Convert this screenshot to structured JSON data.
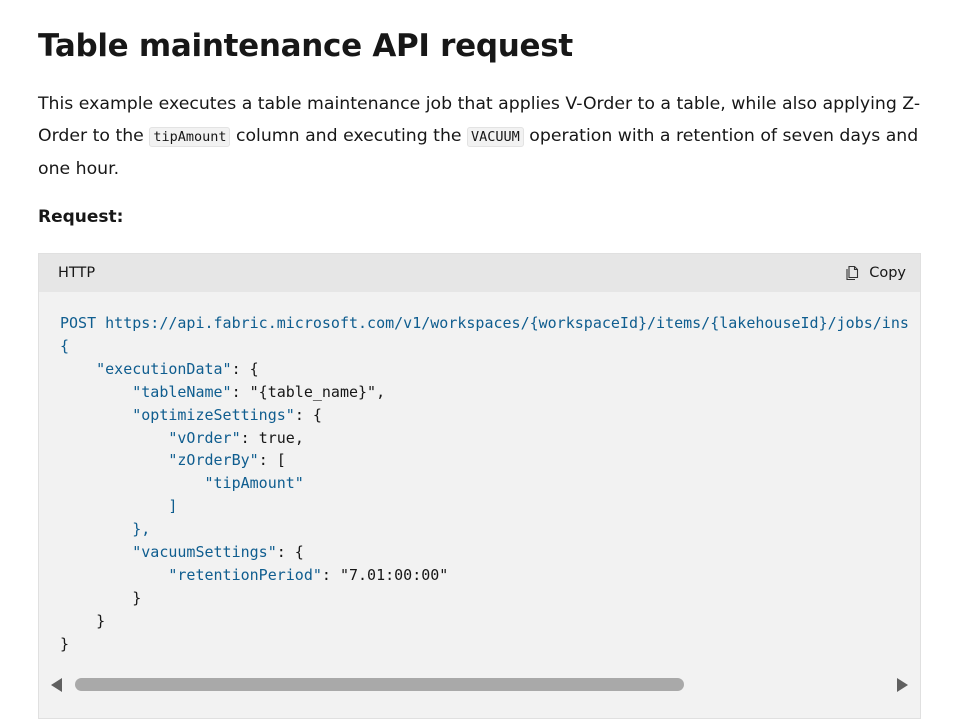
{
  "heading": "Table maintenance API request",
  "paragraph": {
    "line1": "This example executes a table maintenance job that applies V-Order to a table, while also applying Z-",
    "line2_pre": "Order to the ",
    "line2_code1": "tipAmount",
    "line2_mid": " column and executing the ",
    "line2_code2": "VACUUM",
    "line2_post": " operation with a retention of seven days and",
    "line3": "one hour."
  },
  "request_label": "Request:",
  "code_block": {
    "language": "HTTP",
    "copy_label": "Copy",
    "method": "POST",
    "url": "https://api.fabric.microsoft.com/v1/workspaces/{workspaceId}/items/{lakehouseId}/jobs/ins",
    "keys": {
      "executionData": "\"executionData\"",
      "tableName": "\"tableName\"",
      "tableNameValue": "\"{table_name}\"",
      "optimizeSettings": "\"optimizeSettings\"",
      "vOrder": "\"vOrder\"",
      "vOrderValue": "true",
      "zOrderBy": "\"zOrderBy\"",
      "zOrderByItem": "\"tipAmount\"",
      "vacuumSettings": "\"vacuumSettings\"",
      "retentionPeriod": "\"retentionPeriod\"",
      "retentionPeriodValue": "\"7.01:00:00\""
    }
  },
  "scrollbar": {
    "position": 0.0
  },
  "colors": {
    "code_bg": "#f2f2f2",
    "header_bg": "#e6e6e6",
    "token_blue": "#0f5d8f"
  }
}
